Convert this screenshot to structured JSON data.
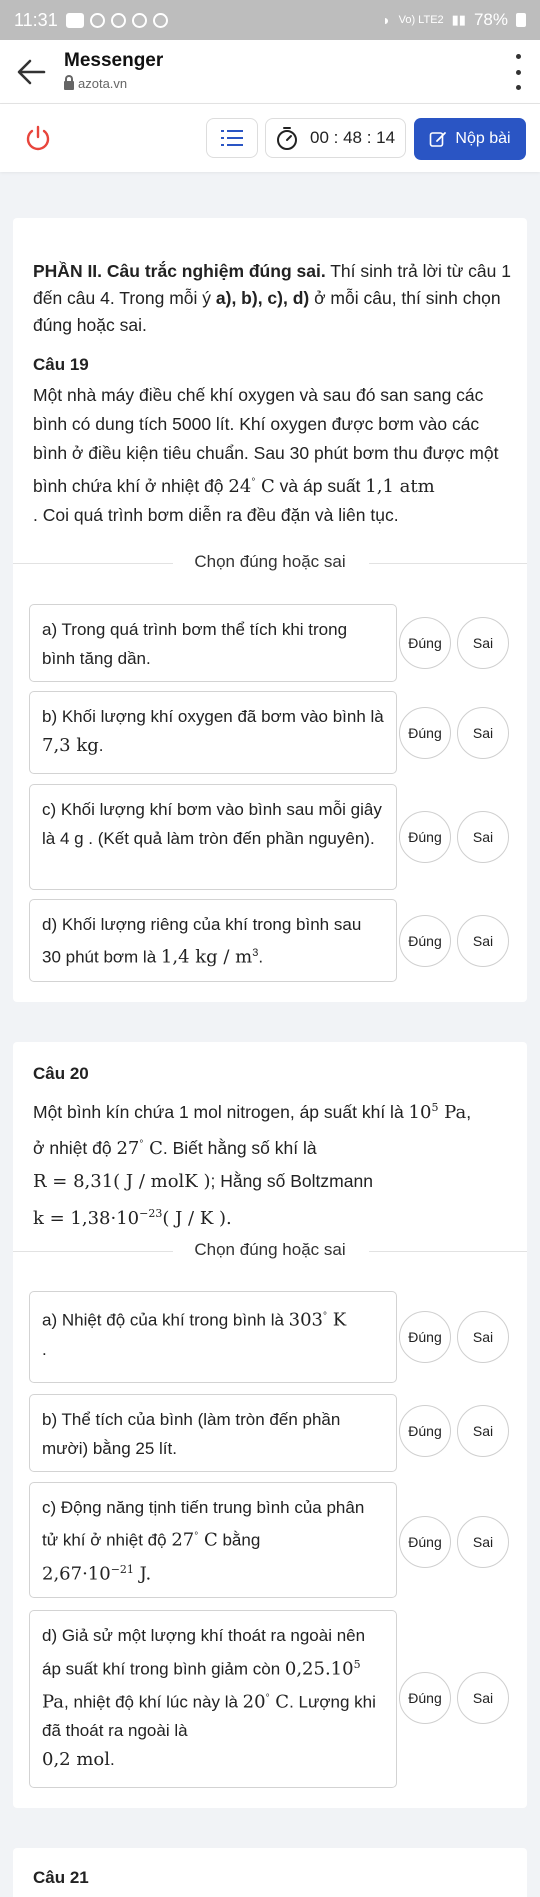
{
  "status_bar": {
    "time": "11:31",
    "network": "Vo) LTE2",
    "battery": "78%"
  },
  "app_bar": {
    "title": "Messenger",
    "url": "azota.vn"
  },
  "toolbar": {
    "timer": "00 : 48 : 14",
    "submit_label": "Nộp bài"
  },
  "section": {
    "heading": "PHẦN II. Câu trắc nghiệm đúng sai.",
    "text_1": " Thí sinh trả lời từ câu 1 đến câu 4. Trong mỗi ý ",
    "text_marks": "a), b), c), d)",
    "text_2": " ở mỗi câu, thí sinh chọn đúng hoặc sai."
  },
  "choose_label": "Chọn đúng hoặc sai",
  "true_label": "Đúng",
  "false_label": "Sai",
  "q19": {
    "title": "Câu 19",
    "text_1": "Một nhà máy điều chế khí oxygen và sau đó san sang các bình có dung tích 5000 lít. Khí oxygen được bơm vào các bình ở điều kiện tiêu chuẩn. Sau 30 phút bơm thu được một bình chứa khí ở nhiệt độ ",
    "temp": "24",
    "text_2": " và áp suất ",
    "pressure": "1,1 atm",
    "text_3": ". Coi quá trình bơm diễn ra đều đặn và liên tục.",
    "options": [
      {
        "text": "a) Trong quá trình bơm thể tích khi trong bình tăng dần."
      },
      {
        "text": "b) Khối lượng khí oxygen đã bơm vào bình là ",
        "math": "7,3 kg",
        "tail": "."
      },
      {
        "text": "c) Khối lượng khí bơm vào bình sau mỗi giây là 4 g . (Kết quả làm tròn đến phần nguyên)."
      },
      {
        "text": "d) Khối lượng riêng của khí trong bình sau 30 phút bơm là ",
        "math": "1,4 kg / m",
        "tail": "."
      }
    ]
  },
  "q20": {
    "title": "Câu 20",
    "text_1": "Một bình kín chứa 1 mol nitrogen, áp suất khí là ",
    "p_base": "10",
    "p_exp": "5",
    "p_unit": " Pa",
    "text_2": "ở nhiệt độ ",
    "temp": "27",
    "text_3": ". Biết hằng số khí là",
    "r_const": "R = 8,31( J / molK )",
    "text_4": "; Hằng số Boltzmann",
    "k_const": "k = 1,38·10",
    "k_exp": "−23",
    "k_unit": "( J / K ).",
    "options": [
      {
        "text": "a) Nhiệt độ của khí trong bình là ",
        "math": "303",
        "tail": " K"
      },
      {
        "text": "b) Thể tích của bình (làm tròn đến phần mười) bằng 25 lít."
      },
      {
        "text": "c) Động năng tịnh tiến trung bình của phân tử khí ở nhiệt độ ",
        "math": "27",
        "tail": " C",
        "mid": " bằng",
        "line2": "2,67·10",
        "line2_exp": "−21",
        "line2_unit": " J."
      },
      {
        "text": "d) Giả sử một lượng khí thoát ra ngoài nên áp suất khí trong bình giảm còn ",
        "math": "0,25.10",
        "math_exp": "5",
        "tail": " Pa",
        "mid": ", nhiệt độ khí lúc này là ",
        "line2": "20",
        "line2_unit": " C",
        "line3": ". Lượng khi đã thoát ra ngoài là ",
        "line4": "0,2 mol"
      }
    ]
  },
  "q21": {
    "title": "Câu 21"
  },
  "icons": {
    "back": "arrow-left-icon",
    "power": "power-icon",
    "list": "list-icon",
    "timer": "stopwatch-icon",
    "submit": "edit-icon"
  },
  "colors": {
    "accent": "#2a55c4",
    "status_bar": "#bdbdbd"
  }
}
